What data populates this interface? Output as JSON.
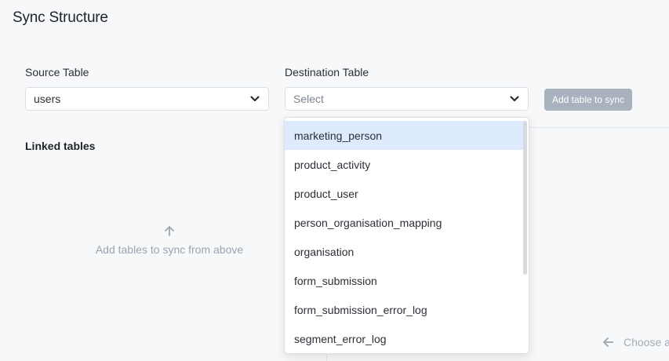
{
  "page": {
    "title": "Sync Structure"
  },
  "source": {
    "label": "Source Table",
    "value": "users",
    "icon": "chevron-down-icon"
  },
  "destination": {
    "label": "Destination Table",
    "placeholder": "Select",
    "icon": "chevron-down-icon",
    "options": [
      "marketing_person",
      "product_activity",
      "product_user",
      "person_organisation_mapping",
      "organisation",
      "form_submission",
      "form_submission_error_log",
      "segment_error_log"
    ],
    "highlighted_option": "marketing_person"
  },
  "actions": {
    "add_label": "Add table to sync"
  },
  "linked": {
    "title": "Linked tables",
    "empty_text": "Add tables to sync from above",
    "empty_icon": "arrow-up-icon"
  },
  "detail": {
    "hint_text": "Choose a",
    "hint_icon": "arrow-left-icon"
  },
  "colors": {
    "highlight": "#deebff",
    "button_disabled": "#a9b3bf",
    "muted_text": "#9aa4b1"
  }
}
